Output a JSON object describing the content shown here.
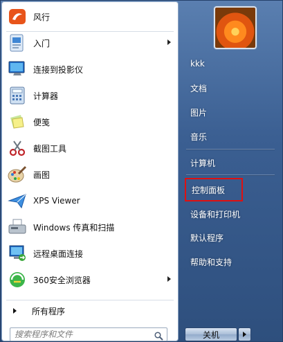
{
  "programs": [
    {
      "label": "风行",
      "icon": "fengxing-icon",
      "submenu": false
    },
    {
      "label": "入门",
      "icon": "getting-started-icon",
      "submenu": true
    },
    {
      "label": "连接到投影仪",
      "icon": "projector-icon",
      "submenu": false
    },
    {
      "label": "计算器",
      "icon": "calculator-icon",
      "submenu": false
    },
    {
      "label": "便笺",
      "icon": "sticky-notes-icon",
      "submenu": false
    },
    {
      "label": "截图工具",
      "icon": "snipping-tool-icon",
      "submenu": false
    },
    {
      "label": "画图",
      "icon": "paint-icon",
      "submenu": false
    },
    {
      "label": "XPS Viewer",
      "icon": "xps-viewer-icon",
      "submenu": false
    },
    {
      "label": "Windows 传真和扫描",
      "icon": "fax-scan-icon",
      "submenu": false
    },
    {
      "label": "远程桌面连接",
      "icon": "remote-desktop-icon",
      "submenu": false
    },
    {
      "label": "360安全浏览器",
      "icon": "360-browser-icon",
      "submenu": true
    }
  ],
  "all_programs_label": "所有程序",
  "search": {
    "placeholder": "搜索程序和文件"
  },
  "right": {
    "items": [
      {
        "label": "kkk"
      },
      {
        "label": "文档"
      },
      {
        "label": "图片"
      },
      {
        "label": "音乐"
      },
      {
        "label": "计算机"
      },
      {
        "label": "控制面板",
        "highlighted": true
      },
      {
        "label": "设备和打印机"
      },
      {
        "label": "默认程序"
      },
      {
        "label": "帮助和支持"
      }
    ],
    "shutdown_label": "关机"
  },
  "colors": {
    "highlight_border": "#e01010",
    "panel_blue": "#3b5f92"
  }
}
